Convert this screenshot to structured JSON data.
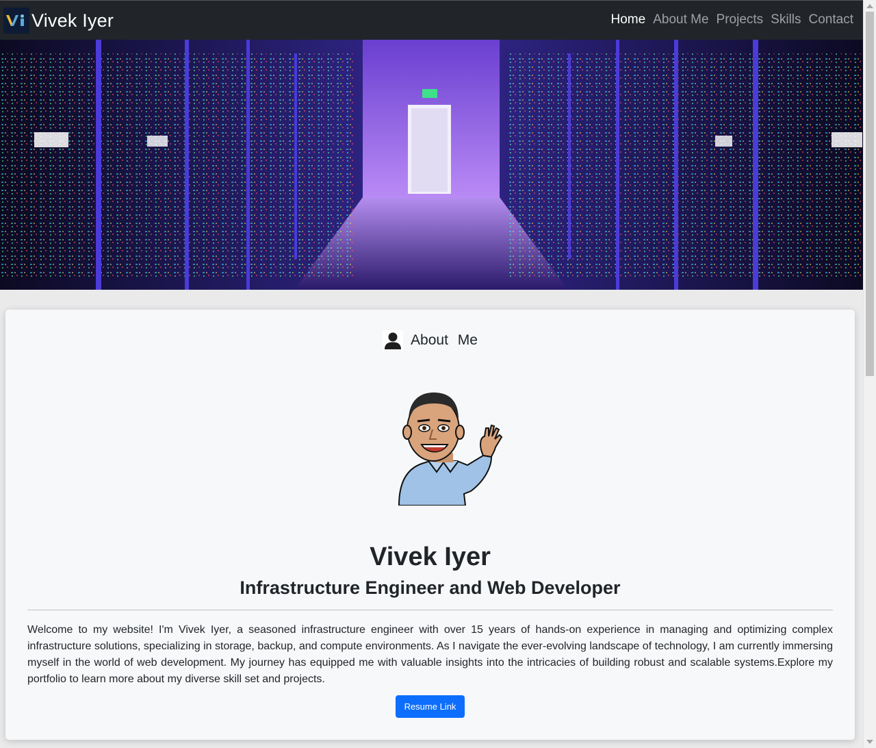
{
  "navbar": {
    "brand_logo_text": "Vi",
    "brand_name": "Vivek Iyer",
    "links": [
      {
        "label": "Home",
        "active": true
      },
      {
        "label": "About Me",
        "active": false
      },
      {
        "label": "Projects",
        "active": false
      },
      {
        "label": "Skills",
        "active": false
      },
      {
        "label": "Contact",
        "active": false
      }
    ]
  },
  "hero": {
    "image": "server-room-corridor-purple"
  },
  "about": {
    "icon": "person-icon",
    "title": "About Me",
    "avatar": "waving-cartoon-avatar",
    "name": "Vivek Iyer",
    "role": "Infrastructure Engineer and Web Developer",
    "bio": "Welcome to my website! I'm Vivek Iyer, a seasoned infrastructure engineer with over 15 years of hands-on experience in managing and optimizing complex infrastructure solutions, specializing in storage, backup, and compute environments. As I navigate the ever-evolving landscape of technology, I am currently immersing myself in the world of web development. My journey has equipped me with valuable insights into the intricacies of building robust and scalable systems.Explore my portfolio to learn more about my diverse skill set and projects.",
    "resume_button": "Resume Link"
  },
  "colors": {
    "navbar_bg": "#212529",
    "nav_active": "#ffffff",
    "nav_inactive": "#9ea2a6",
    "card_bg": "#f7f8fa",
    "button_bg": "#0d6efd"
  }
}
